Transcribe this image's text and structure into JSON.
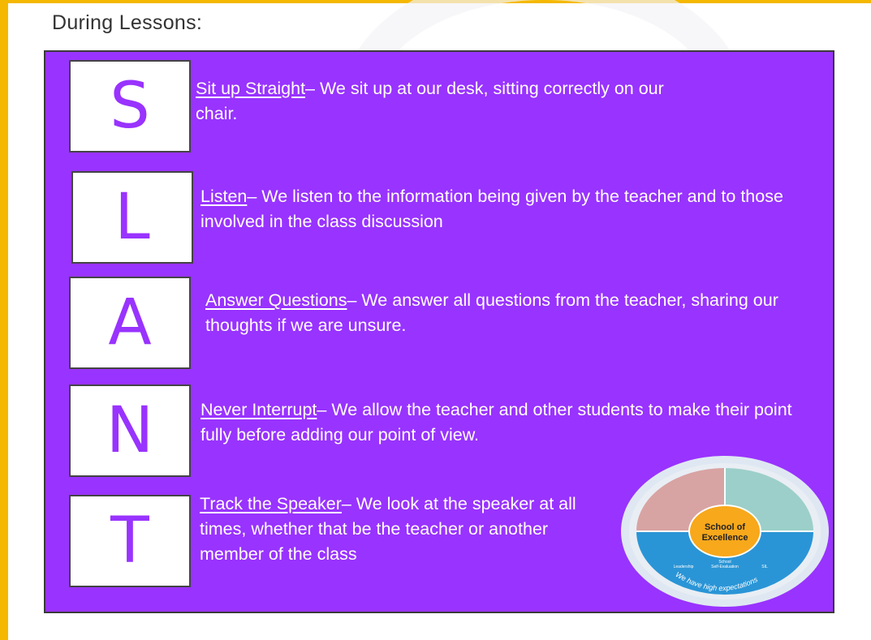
{
  "heading": "During Lessons:",
  "items": [
    {
      "letter": "S",
      "term": "Sit up Straight",
      "text": "– We sit up at our desk, sitting correctly on our chair."
    },
    {
      "letter": "L",
      "term": "Listen",
      "text": "– We listen to the information being given by the teacher and to those involved in the class discussion"
    },
    {
      "letter": "A",
      "term": "Answer Questions",
      "text": "– We answer all questions from the teacher, sharing our thoughts if we are unsure."
    },
    {
      "letter": "N",
      "term": "Never Interrupt",
      "text": "– We allow the teacher and other students to make their point fully before adding our point of view."
    },
    {
      "letter": "T",
      "term": "Track the Speaker",
      "text": "– We look at the speaker at all times, whether that be the teacher or another member of the class"
    }
  ],
  "badge": {
    "center_line1": "School of",
    "center_line2": "Excellence",
    "arc_text": "We have high expectations",
    "label_leadership": "Leadership",
    "label_school": "School",
    "label_self_eval": "Self-Evaluation",
    "label_sil": "SIL"
  },
  "colors": {
    "panel": "#9933ff",
    "accent": "#f5b800",
    "badge_orange": "#f7a81b",
    "badge_blue": "#2a95d6",
    "badge_red": "#d8a3a3",
    "badge_teal": "#9ccfc9"
  }
}
